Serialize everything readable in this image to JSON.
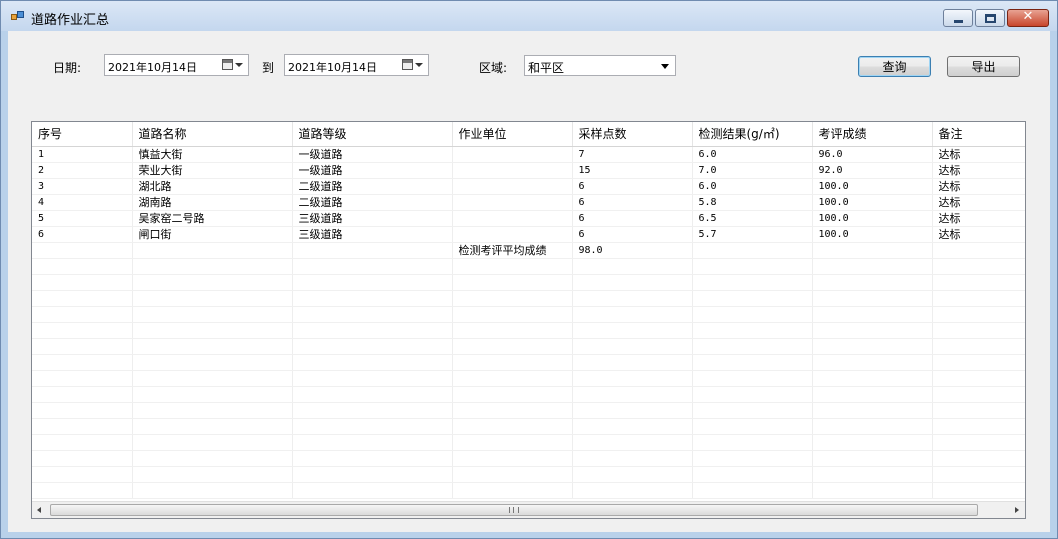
{
  "window": {
    "title": "道路作业汇总",
    "close_glyph": "✕"
  },
  "filters": {
    "date_label": "日期:",
    "date_from": "2021年10月14日",
    "to_label": "到",
    "date_to": "2021年10月14日",
    "area_label": "区域:",
    "area_value": "和平区"
  },
  "buttons": {
    "query": "查询",
    "export": "导出"
  },
  "table": {
    "headers": [
      "序号",
      "道路名称",
      "道路等级",
      "作业单位",
      "采样点数",
      "检测结果(g/㎡)",
      "考评成绩",
      "备注"
    ],
    "rows": [
      [
        "1",
        "慎益大街",
        "一级道路",
        "",
        "7",
        "6.0",
        "96.0",
        "达标"
      ],
      [
        "2",
        "荣业大街",
        "一级道路",
        "",
        "15",
        "7.0",
        "92.0",
        "达标"
      ],
      [
        "3",
        "湖北路",
        "二级道路",
        "",
        "6",
        "6.0",
        "100.0",
        "达标"
      ],
      [
        "4",
        "湖南路",
        "二级道路",
        "",
        "6",
        "5.8",
        "100.0",
        "达标"
      ],
      [
        "5",
        "吴家窑二号路",
        "三级道路",
        "",
        "6",
        "6.5",
        "100.0",
        "达标"
      ],
      [
        "6",
        "闸口街",
        "三级道路",
        "",
        "6",
        "5.7",
        "100.0",
        "达标"
      ],
      [
        "",
        "",
        "",
        "检测考评平均成绩",
        "98.0",
        "",
        "",
        ""
      ]
    ],
    "empty_rows": 15
  },
  "scrollbar": {
    "grip_glyph": "|||"
  }
}
